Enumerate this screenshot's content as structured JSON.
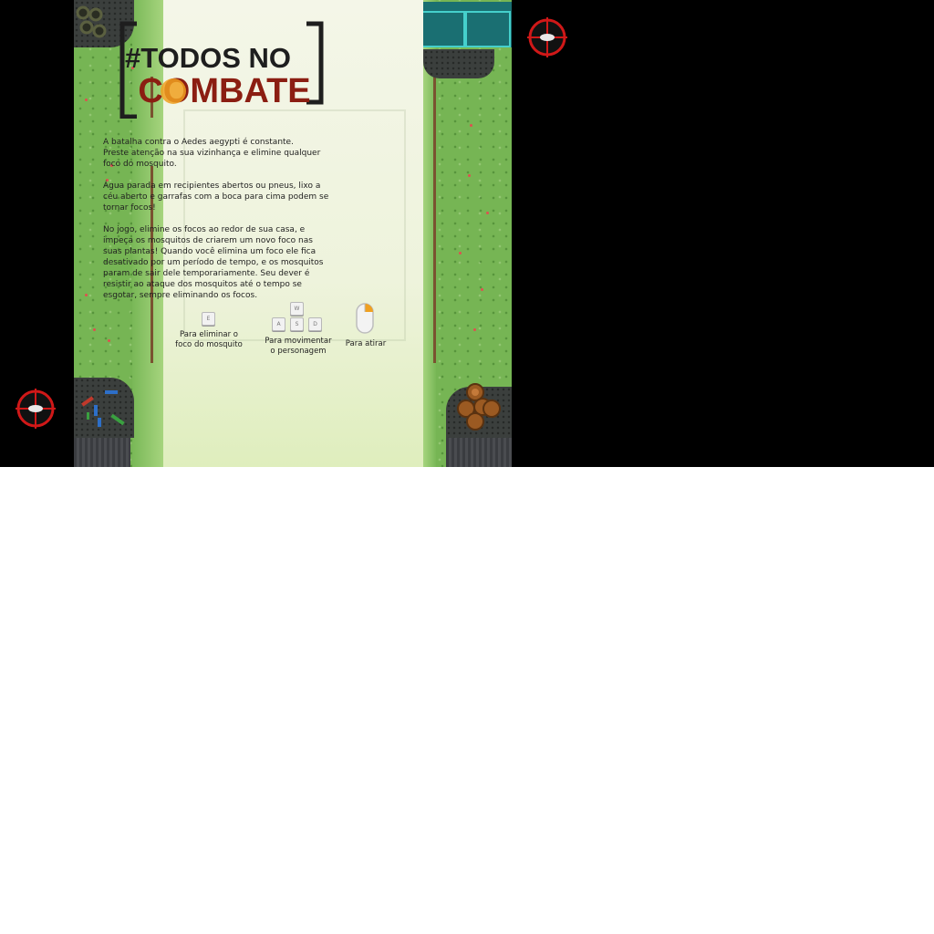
{
  "intro": {
    "paragraph_1": "A batalha contra o Aedes aegypti é constante.\nPreste atenção na sua vizinhança e elimine qualquer foco do mosquito.",
    "paragraph_2": "Água parada em recipientes abertos ou pneus, lixo a céu aberto e garrafas com a boca para cima podem se tornar focos!",
    "paragraph_3": "No jogo, elimine os focos ao redor de sua casa, e impeça os mosquitos de criarem um novo foco nas suas plantas! Quando você elimina um foco ele fica desativado por um período de tempo, e os mosquitos param de sair dele temporariamente. Seu dever é resistir ao ataque dos mosquitos até o tempo se esgotar, sempre eliminando os focos."
  },
  "logo": {
    "line_1": "#TODOS NO",
    "line_2": "COMBATE"
  },
  "controls": {
    "eliminate": {
      "key": "E",
      "label": "Para eliminar o\nfoco do mosquito"
    },
    "move": {
      "keys": [
        "W",
        "A",
        "S",
        "D"
      ],
      "label": "Para movimentar\no personagem"
    },
    "shoot": {
      "icon": "mouse-icon",
      "label": "Para atirar"
    }
  },
  "colors": {
    "grass": "#76b554",
    "panel": "#eef3dc",
    "logo_dark": "#1e1e1e",
    "logo_red": "#8b1e12",
    "target_red": "#d01818",
    "accent_orange": "#f0a020"
  }
}
